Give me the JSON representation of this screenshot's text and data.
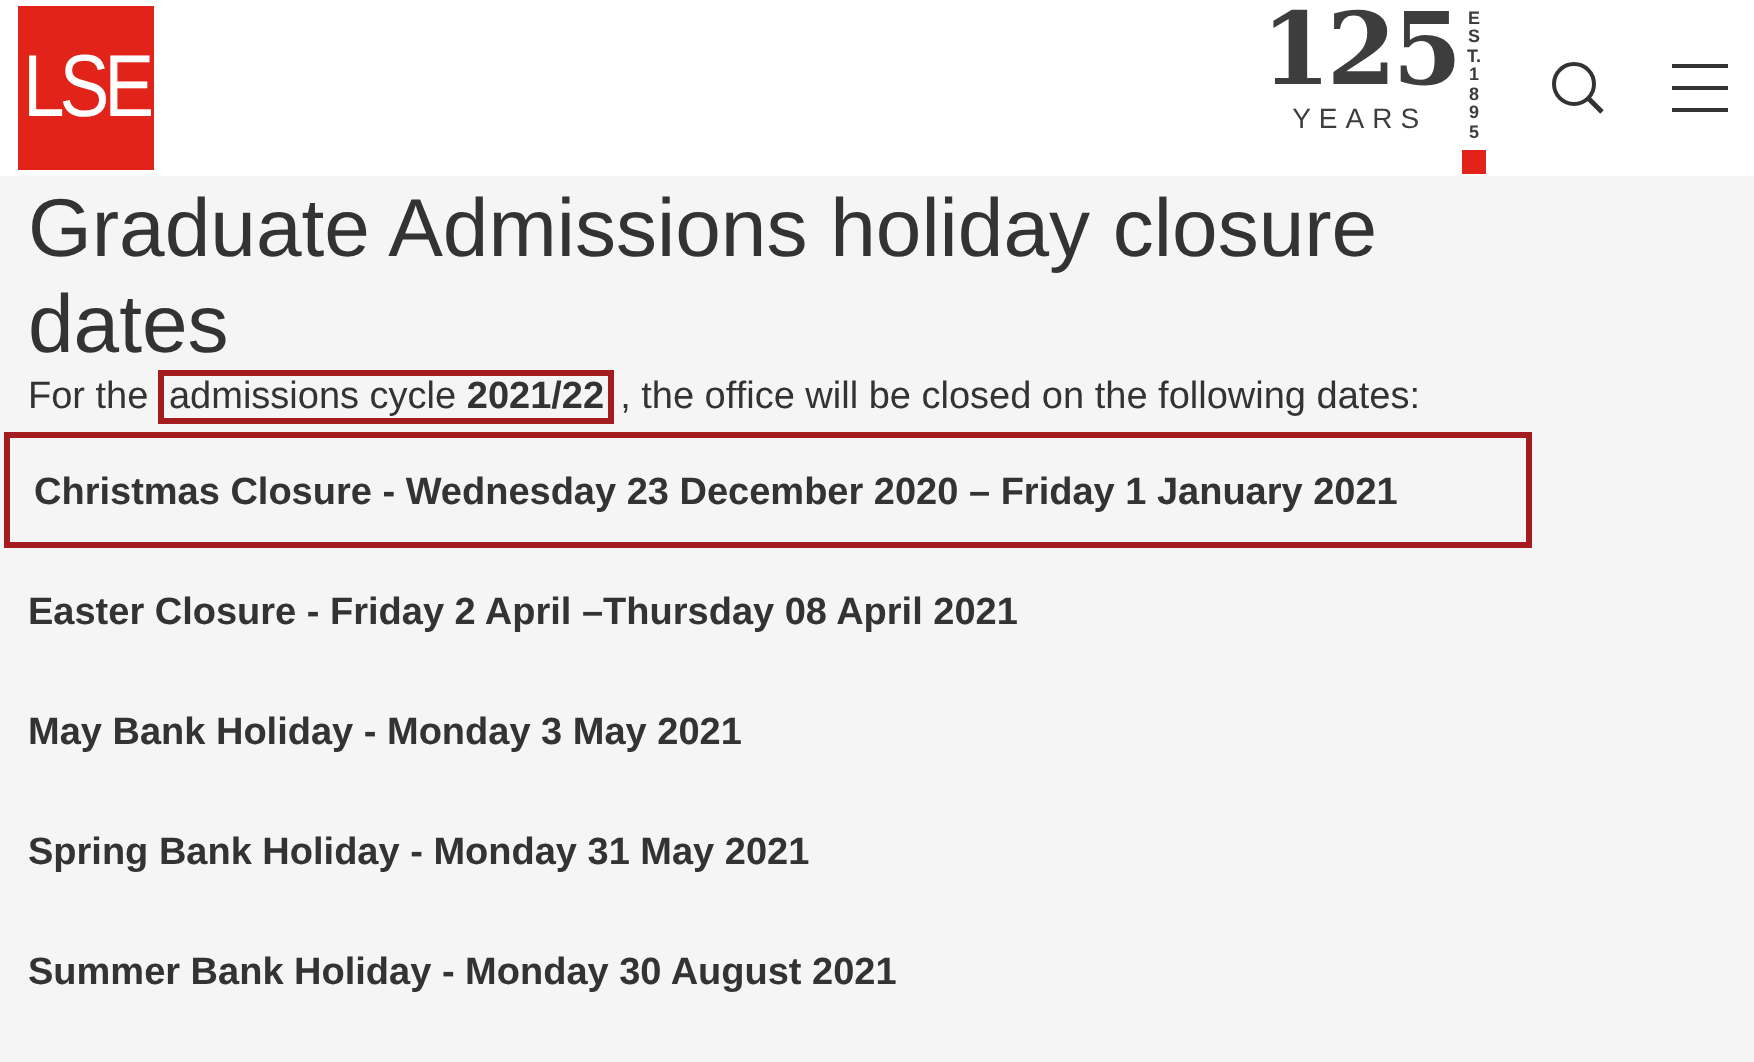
{
  "header": {
    "logo": "LSE",
    "anniversary": {
      "number": "125",
      "word": "YEARS",
      "est": "EST. 1895"
    }
  },
  "title": "Graduate Admissions holiday closure dates",
  "intro": [
    {
      "text": "For the ",
      "highlighted": false
    },
    {
      "text": "admissions cycle **2021/22**",
      "highlighted": true
    },
    {
      "text": ", the office will be closed on the following dates:",
      "highlighted": false
    }
  ],
  "dates": [
    {
      "text": "Christmas Closure - Wednesday 23 December 2020 – Friday 1 January 2021",
      "highlighted": true
    },
    {
      "text": "Easter Closure - Friday 2 April –Thursday 08 April 2021",
      "highlighted": false
    },
    {
      "text": "May Bank Holiday - Monday 3 May 2021",
      "highlighted": false
    },
    {
      "text": "Spring Bank Holiday - Monday 31 May 2021",
      "highlighted": false
    },
    {
      "text": "Summer Bank Holiday - Monday 30 August 2021",
      "highlighted": false
    }
  ]
}
